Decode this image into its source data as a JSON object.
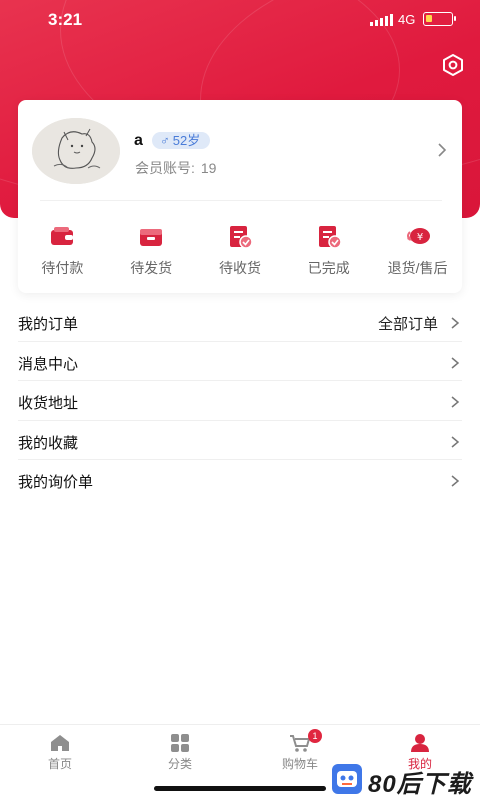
{
  "status_bar": {
    "time": "3:21",
    "network": "4G"
  },
  "profile": {
    "username": "a",
    "gender_symbol": "♂",
    "age": "52岁",
    "member_label": "会员账号:",
    "member_id": "19"
  },
  "order_status": [
    {
      "label": "待付款",
      "icon": "wallet-icon"
    },
    {
      "label": "待发货",
      "icon": "box-icon"
    },
    {
      "label": "待收货",
      "icon": "receipt-check-icon"
    },
    {
      "label": "已完成",
      "icon": "receipt-done-icon"
    },
    {
      "label": "退货/售后",
      "icon": "refund-icon"
    }
  ],
  "menu": [
    {
      "label": "我的订单",
      "extra": "全部订单"
    },
    {
      "label": "消息中心"
    },
    {
      "label": "收货地址"
    },
    {
      "label": "我的收藏"
    },
    {
      "label": "我的询价单"
    }
  ],
  "tabs": [
    {
      "label": "首页",
      "icon": "home-icon"
    },
    {
      "label": "分类",
      "icon": "grid-icon"
    },
    {
      "label": "购物车",
      "icon": "cart-icon",
      "badge": "1"
    },
    {
      "label": "我的",
      "icon": "user-icon",
      "active": true
    }
  ],
  "watermark": {
    "text": "80后下载"
  },
  "colors": {
    "brand": "#e01a3e",
    "badge": "#4a7cd8",
    "active_tab": "#d8243f"
  }
}
